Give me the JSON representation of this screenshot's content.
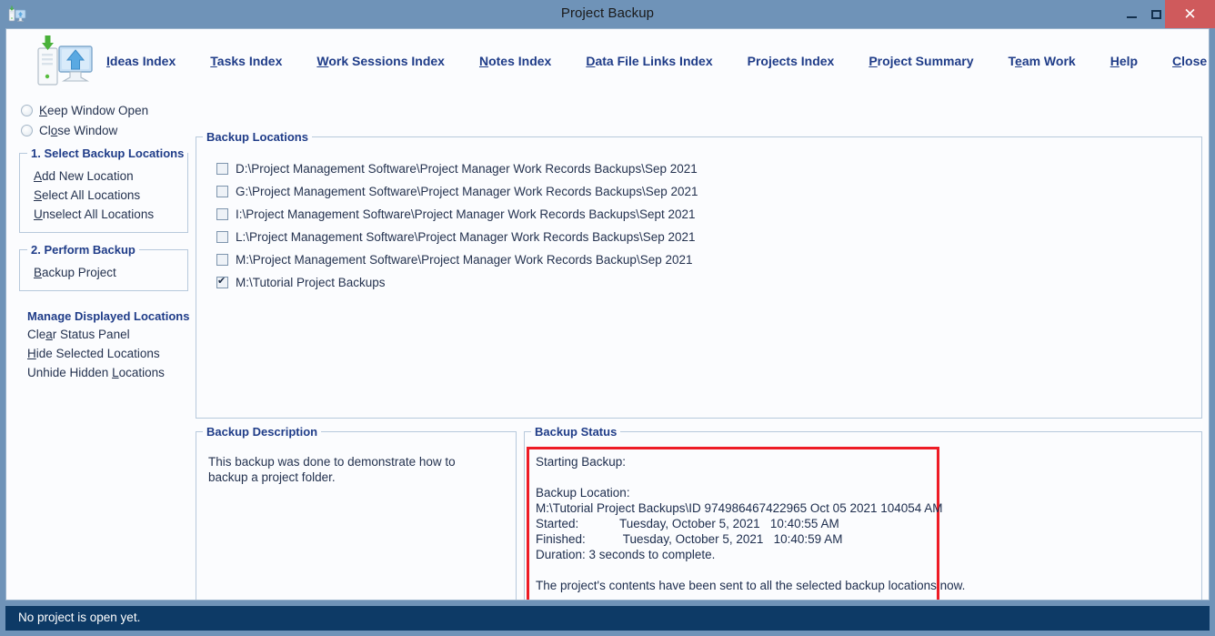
{
  "window": {
    "title": "Project Backup",
    "icon": "backup-app-icon",
    "controls": {
      "minimize": "minimize-icon",
      "maximize": "maximize-icon",
      "close": "close-icon"
    }
  },
  "nav": {
    "items": [
      {
        "label": "Ideas Index",
        "accel": "I"
      },
      {
        "label": "Tasks Index",
        "accel": "T"
      },
      {
        "label": "Work Sessions Index",
        "accel": "W"
      },
      {
        "label": "Notes Index",
        "accel": "N"
      },
      {
        "label": "Data File Links Index",
        "accel": "D"
      },
      {
        "label": "Projects Index",
        "accel": ""
      },
      {
        "label": "Project Summary",
        "accel": "P"
      },
      {
        "label": "Team Work",
        "accel": "e"
      },
      {
        "label": "Help",
        "accel": "H"
      },
      {
        "label": "Close Program",
        "accel": "C"
      }
    ]
  },
  "sidebar": {
    "radios": [
      {
        "label": "Keep Window Open",
        "accel": "K",
        "selected": false
      },
      {
        "label": "Close Window",
        "accel": "o",
        "selected": false
      }
    ],
    "group1": {
      "title": "1. Select Backup Locations",
      "links": [
        {
          "label": "Add New Location",
          "accel": "A"
        },
        {
          "label": "Select All Locations",
          "accel": "S"
        },
        {
          "label": "Unselect All Locations",
          "accel": "U"
        }
      ]
    },
    "group2": {
      "title": "2. Perform Backup",
      "links": [
        {
          "label": "Backup Project",
          "accel": "B"
        }
      ]
    },
    "manage": {
      "title": "Manage Displayed Locations",
      "links": [
        {
          "label": "Clear Status Panel",
          "accel": "a"
        },
        {
          "label": "Hide Selected Locations",
          "accel": "H"
        },
        {
          "label": "Unhide Hidden Locations",
          "accel": "L"
        }
      ]
    }
  },
  "locations_panel": {
    "title": "Backup Locations",
    "items": [
      {
        "label": "D:\\Project Management Software\\Project Manager Work Records Backups\\Sep 2021",
        "checked": false
      },
      {
        "label": "G:\\Project Management Software\\Project Manager Work Records Backups\\Sep 2021",
        "checked": false
      },
      {
        "label": "I:\\Project Management Software\\Project Manager Work Records Backups\\Sept 2021",
        "checked": false
      },
      {
        "label": "L:\\Project Management Software\\Project Manager Work Records Backups\\Sep 2021",
        "checked": false
      },
      {
        "label": "M:\\Project Management Software\\Project Manager Work Records Backup\\Sep 2021",
        "checked": false
      },
      {
        "label": "M:\\Tutorial Project Backups",
        "checked": true
      }
    ]
  },
  "description_panel": {
    "title": "Backup Description",
    "text": "This backup was done to demonstrate how to backup a project folder."
  },
  "status_panel": {
    "title": "Backup Status",
    "highlight_color": "#ee1c25",
    "text": "Starting Backup:\n\nBackup Location:\nM:\\Tutorial Project Backups\\ID 974986467422965 Oct 05 2021 104054 AM\nStarted:            Tuesday, October 5, 2021   10:40:55 AM\nFinished:           Tuesday, October 5, 2021   10:40:59 AM\nDuration: 3 seconds to complete.\n\nThe project's contents have been sent to all the selected backup locations now."
  },
  "statusbar": {
    "text": "No project is open yet."
  }
}
